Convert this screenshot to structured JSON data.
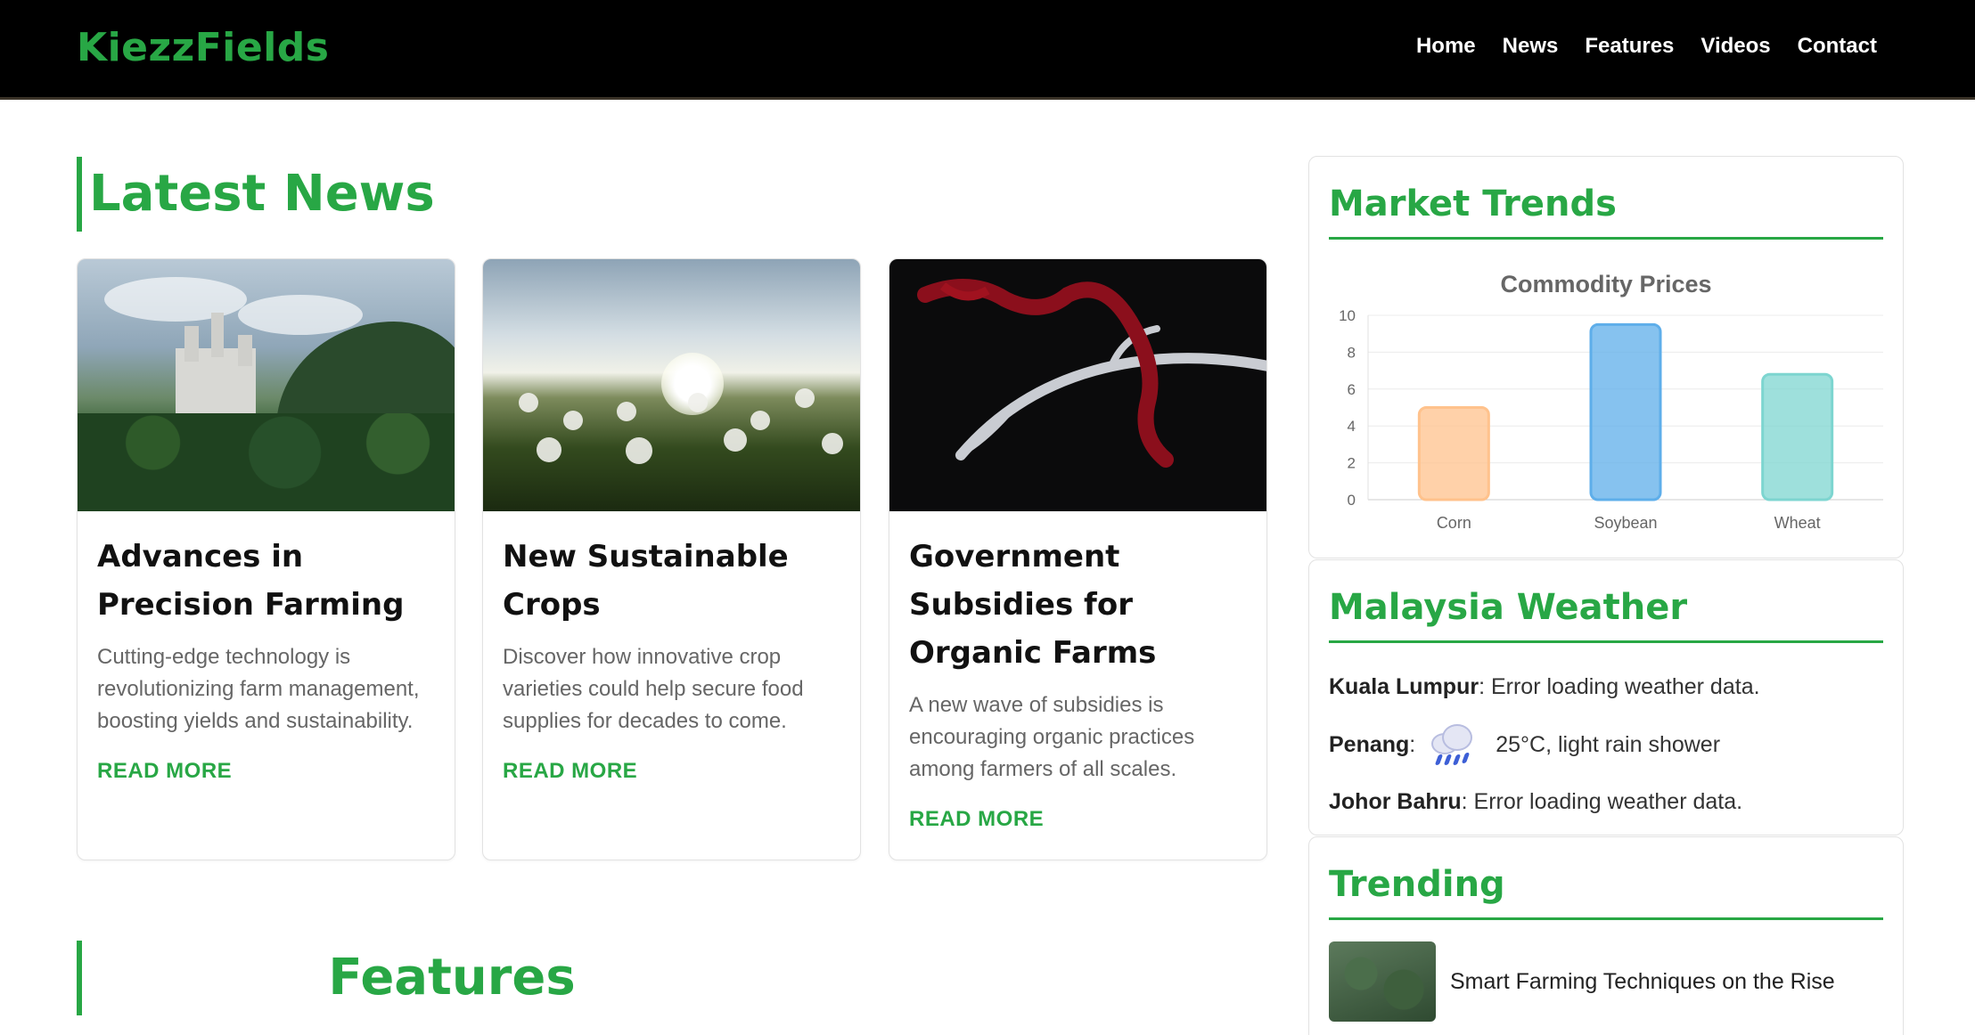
{
  "header": {
    "brand": "KiezzFields",
    "nav": [
      "Home",
      "News",
      "Features",
      "Videos",
      "Contact"
    ]
  },
  "latest_news": {
    "title": "Latest News",
    "cards": [
      {
        "title": "Advances in Precision Farming",
        "text": "Cutting-edge technology is revolutionizing farm management, boosting yields and sustainability.",
        "link": "READ MORE",
        "image": "castle-forest-photo"
      },
      {
        "title": "New Sustainable Crops",
        "text": "Discover how innovative crop varieties could help secure food supplies for decades to come.",
        "link": "READ MORE",
        "image": "dandelion-field-photo"
      },
      {
        "title": "Government Subsidies for Organic Farms",
        "text": "A new wave of subsidies is encouraging organic practices among farmers of all scales.",
        "link": "READ MORE",
        "image": "antler-red-ribbon-photo"
      }
    ]
  },
  "features": {
    "title": "Features"
  },
  "market": {
    "title": "Market Trends",
    "chart_data": {
      "type": "bar",
      "title": "Commodity Prices",
      "categories": [
        "Corn",
        "Soybean",
        "Wheat"
      ],
      "values": [
        5,
        9.5,
        6.8
      ],
      "colors": [
        "#ffc28c",
        "#5eaeea",
        "#7dd5d0"
      ],
      "ylim": [
        0,
        10
      ],
      "yticks": [
        0,
        2,
        4,
        6,
        8,
        10
      ],
      "xlabel": "",
      "ylabel": "",
      "grid": true
    }
  },
  "weather": {
    "title": "Malaysia Weather",
    "rows": [
      {
        "city": "Kuala Lumpur",
        "sep": ":",
        "text": " Error loading weather data."
      },
      {
        "city": "Penang",
        "sep": ":",
        "text": "25°C, light rain shower",
        "icon": "rain-cloud-icon"
      },
      {
        "city": "Johor Bahru",
        "sep": ":",
        "text": " Error loading weather data."
      }
    ]
  },
  "trending": {
    "title": "Trending",
    "items": [
      {
        "text": "Smart Farming Techniques on the Rise"
      }
    ]
  },
  "colors": {
    "accent": "#28a745",
    "header_bg": "#000000"
  }
}
